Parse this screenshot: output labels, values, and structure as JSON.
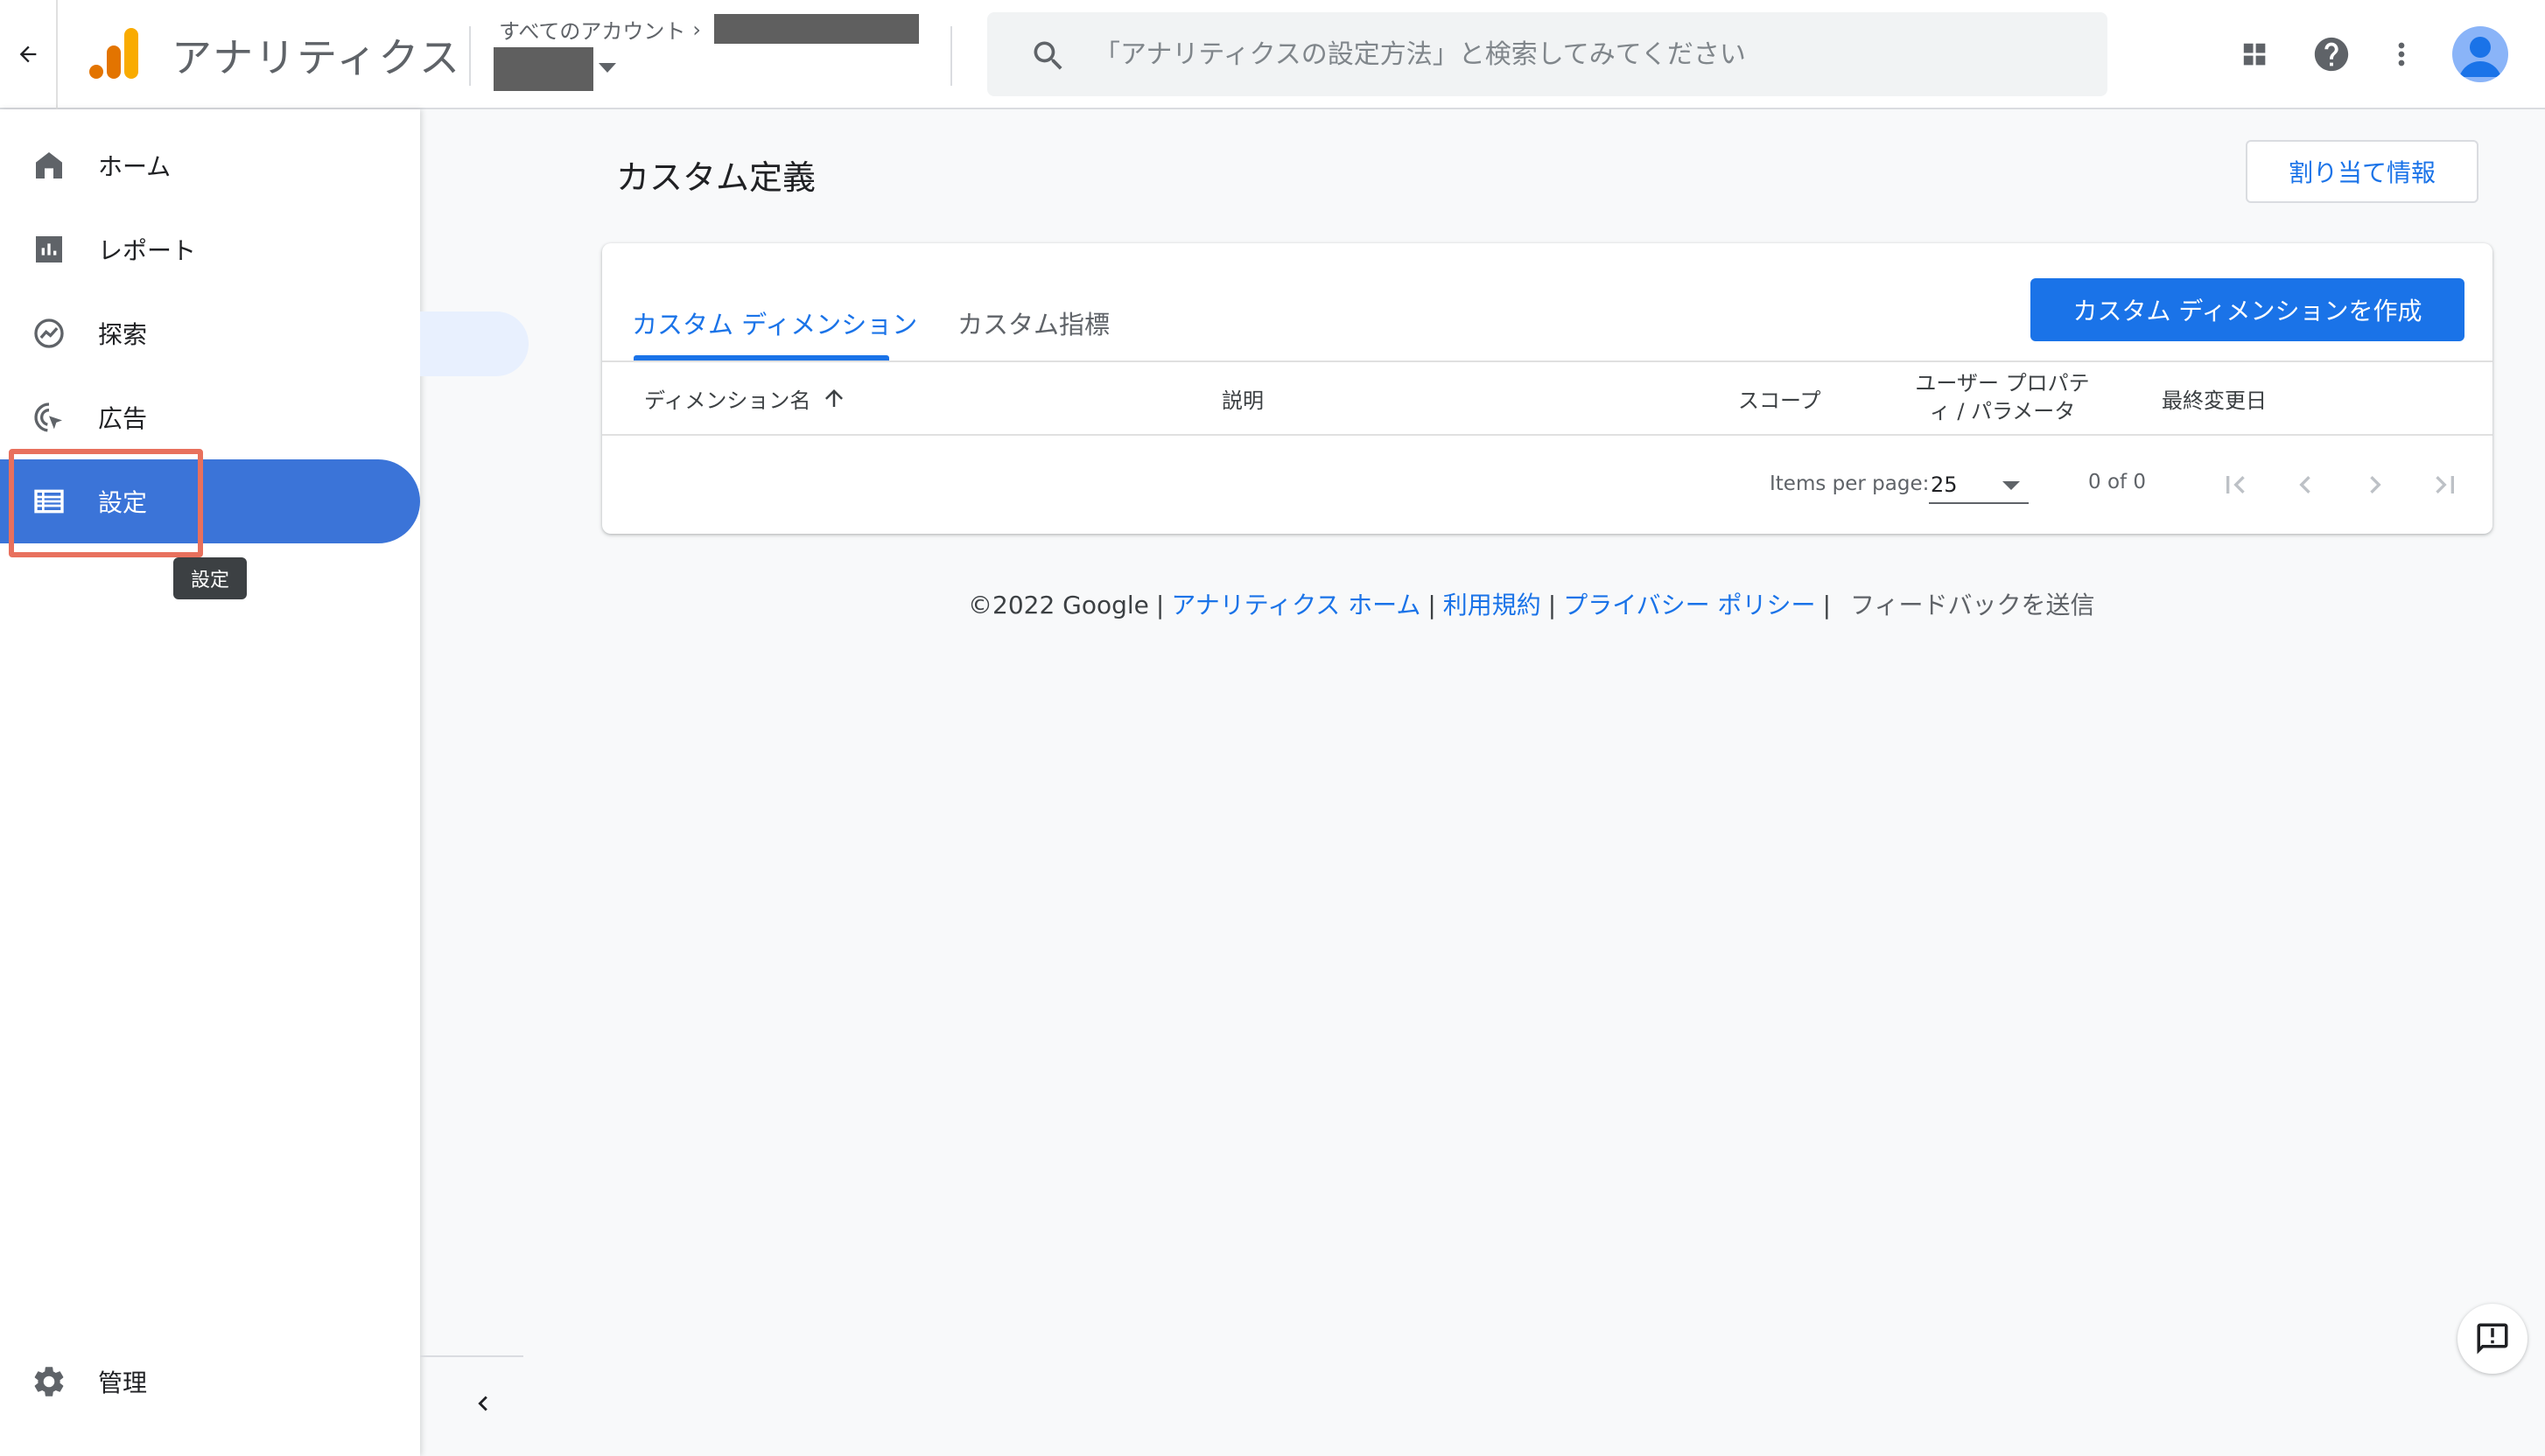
{
  "header": {
    "app_title": "アナリティクス",
    "account_breadcrumb": "すべてのアカウント",
    "breadcrumb_separator": "›",
    "search_placeholder": "「アナリティクスの設定方法」と検索してみてください",
    "icons": [
      "arrow-back-icon",
      "analytics-logo",
      "search-icon",
      "apps-grid-icon",
      "help-icon",
      "more-vert-icon",
      "avatar"
    ]
  },
  "leftnav": {
    "items": [
      {
        "label": "ホーム",
        "icon": "home-icon"
      },
      {
        "label": "レポート",
        "icon": "bar-chart-icon"
      },
      {
        "label": "探索",
        "icon": "explore-icon"
      },
      {
        "label": "広告",
        "icon": "ads-cursor-icon"
      },
      {
        "label": "設定",
        "icon": "settings-list-icon",
        "active": true
      }
    ],
    "tooltip": "設定",
    "admin_label": "管理"
  },
  "main": {
    "page_title": "カスタム定義",
    "assign_button": "割り当て情報",
    "tabs": [
      {
        "label": "カスタム ディメンション",
        "active": true
      },
      {
        "label": "カスタム指標",
        "active": false
      }
    ],
    "create_button": "カスタム ディメンションを作成",
    "columns": [
      "ディメンション名",
      "説明",
      "スコープ",
      "ユーザー プロパティ / パラメータ",
      "最終変更日"
    ],
    "pagination": {
      "items_per_page_label": "Items per page:",
      "items_per_page_value": "25",
      "range_label": "0 of 0"
    }
  },
  "footer": {
    "copyright": "©2022 Google",
    "links": [
      "アナリティクス ホーム",
      "利用規約",
      "プライバシー ポリシー"
    ],
    "separator": "|",
    "feedback": "フィードバックを送信"
  },
  "colors": {
    "accent": "#1a73e8",
    "active_nav": "#3b74d8",
    "highlight_border": "#e8705d",
    "background": "#f8f9fa"
  }
}
